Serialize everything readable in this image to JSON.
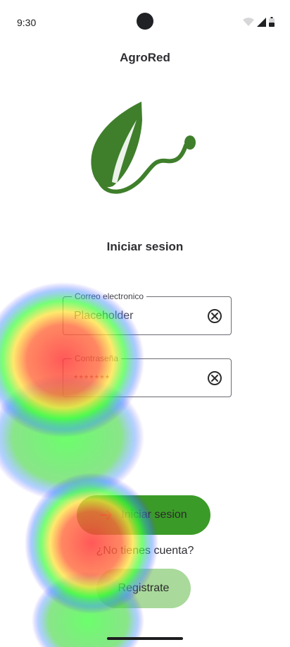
{
  "status_bar": {
    "time": "9:30"
  },
  "app": {
    "title": "AgroRed"
  },
  "login": {
    "section_title": "Iniciar sesion",
    "email": {
      "label": "Correo electronico",
      "value": "Placeholder"
    },
    "password": {
      "label": "Contraseña",
      "value": "*******"
    },
    "submit_label": "Iniciar sesion",
    "no_account_text": "¿No tienes cuenta?",
    "register_label": "Registrate"
  },
  "colors": {
    "brand_green": "#3b9b28",
    "leaf_green": "#3f7f2b",
    "register_bg": "#a9d99b"
  },
  "icons": [
    "wifi-icon",
    "signal-icon",
    "battery-icon",
    "clear-icon",
    "arrow-right-icon"
  ]
}
